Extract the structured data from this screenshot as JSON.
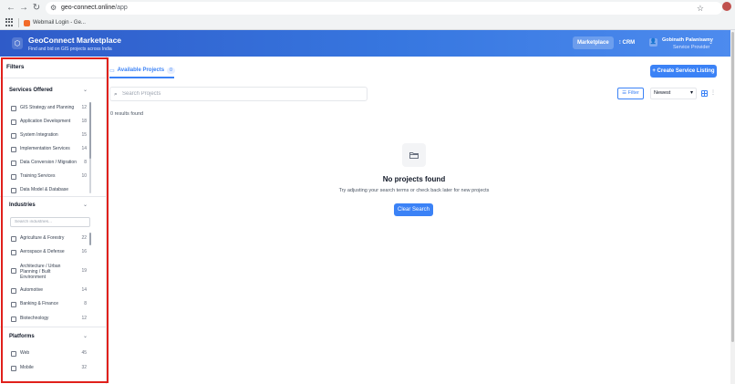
{
  "browser": {
    "url_host": "geo-connect.online",
    "url_path": "/app",
    "bookmark_label": "Webmail Login - Ge..."
  },
  "header": {
    "logo_glyph": "⬡",
    "title": "GeoConnect Marketplace",
    "subtitle": "Find and bid on GIS projects across India",
    "marketplace_label": "Marketplace",
    "crm_label": "CRM",
    "user_name": "Gobinath Palanisamy",
    "user_role": "Service Provider"
  },
  "sidebar": {
    "title": "Filters",
    "services": {
      "title": "Services Offered",
      "options": [
        {
          "label": "GIS Strategy and Planning",
          "count": "12"
        },
        {
          "label": "Application Development",
          "count": "18"
        },
        {
          "label": "System Integration",
          "count": "15"
        },
        {
          "label": "Implementation Services",
          "count": "14"
        },
        {
          "label": "Data Conversion / Migration",
          "count": "8"
        },
        {
          "label": "Training Services",
          "count": "10"
        },
        {
          "label": "Data Model & Database",
          "count": ""
        }
      ]
    },
    "industries": {
      "title": "Industries",
      "search_placeholder": "Search industries...",
      "options": [
        {
          "label": "Agriculture & Forestry",
          "count": "22"
        },
        {
          "label": "Aerospace & Defense",
          "count": "16"
        },
        {
          "label": "Architecture / Urban Planning / Built Environment",
          "count": "19"
        },
        {
          "label": "Automotive",
          "count": "14"
        },
        {
          "label": "Banking & Finance",
          "count": "8"
        },
        {
          "label": "Biotechnology",
          "count": "12"
        }
      ]
    },
    "platforms": {
      "title": "Platforms",
      "options": [
        {
          "label": "Web",
          "count": "45"
        },
        {
          "label": "Mobile",
          "count": "32"
        }
      ]
    }
  },
  "main": {
    "tab_label": "Available Projects",
    "tab_count": "0",
    "create_button": "+ Create Service Listing",
    "search_placeholder": "Search Projects",
    "filter_button": "Filter",
    "sort_value": "Newest",
    "results_text": "0 results found",
    "empty_title": "No projects found",
    "empty_subtitle": "Try adjusting your search terms or check back later for new projects",
    "clear_button": "Clear Search"
  },
  "colors": {
    "accent": "#3b82f6",
    "header_start": "#2f5bc8",
    "header_end": "#4d8bee",
    "highlight": "#e0201b"
  }
}
